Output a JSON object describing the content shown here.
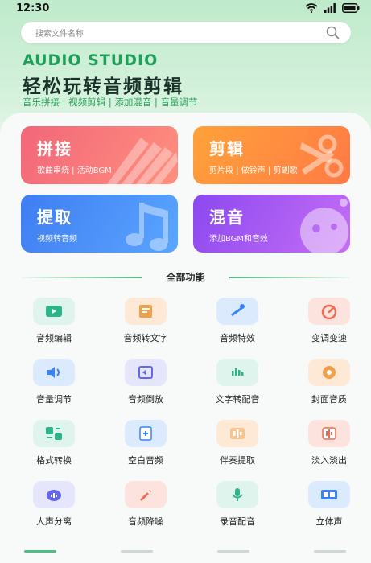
{
  "status": {
    "time": "12:30"
  },
  "search": {
    "placeholder": "搜索文件名称"
  },
  "brand": "AUDIO STUDIO",
  "slogan": "轻松玩转音频剪辑",
  "tags": "音乐拼接 | 视频剪辑 | 添加混音 | 音量调节",
  "cards": [
    {
      "title": "拼接",
      "sub": "歌曲串烧 | 活动BGM",
      "color": "#f2677a"
    },
    {
      "title": "剪辑",
      "sub": "剪片段 | 做铃声 | 剪副歌",
      "color": "#ff8f3a"
    },
    {
      "title": "提取",
      "sub": "视频转音频",
      "color": "#4a8df5"
    },
    {
      "title": "混音",
      "sub": "添加BGM和音效",
      "color": "#a85af3"
    }
  ],
  "section_title": "全部功能",
  "features": [
    {
      "label": "音频编辑",
      "icon": "play-icon",
      "bg": "#dff4ec",
      "fg": "#2fb38a"
    },
    {
      "label": "音频转文字",
      "icon": "document-icon",
      "bg": "#fde9d6",
      "fg": "#f0a04b"
    },
    {
      "label": "音频特效",
      "icon": "magic-wand-icon",
      "bg": "#dbeafd",
      "fg": "#3b82f6"
    },
    {
      "label": "变调变速",
      "icon": "speedometer-icon",
      "bg": "#fde3dd",
      "fg": "#f06a4f"
    },
    {
      "label": "音量调节",
      "icon": "speaker-icon",
      "bg": "#dbeafd",
      "fg": "#3b82f6"
    },
    {
      "label": "音频倒放",
      "icon": "rewind-icon",
      "bg": "#e5e5fb",
      "fg": "#6366f1"
    },
    {
      "label": "文字转配音",
      "icon": "waveform-icon",
      "bg": "#dff4ec",
      "fg": "#2fb38a"
    },
    {
      "label": "封面音质",
      "icon": "disc-icon",
      "bg": "#fde9d6",
      "fg": "#f0a04b"
    },
    {
      "label": "格式转换",
      "icon": "convert-icon",
      "bg": "#dff4ec",
      "fg": "#2fb38a"
    },
    {
      "label": "空白音频",
      "icon": "add-file-icon",
      "bg": "#dbeafd",
      "fg": "#3b82f6"
    },
    {
      "label": "伴奏提取",
      "icon": "extract-icon",
      "bg": "#fde9d6",
      "fg": "#f0a04b"
    },
    {
      "label": "淡入淡出",
      "icon": "fade-wave-icon",
      "bg": "#fde3dd",
      "fg": "#f06a4f"
    },
    {
      "label": "人声分离",
      "icon": "voice-separate-icon",
      "bg": "#e5e5fb",
      "fg": "#6366f1"
    },
    {
      "label": "音频降噪",
      "icon": "rocket-icon",
      "bg": "#fde3dd",
      "fg": "#f06a4f"
    },
    {
      "label": "录音配音",
      "icon": "microphone-icon",
      "bg": "#dff4ec",
      "fg": "#2fb38a"
    },
    {
      "label": "立体声",
      "icon": "stereo-icon",
      "bg": "#dbeafd",
      "fg": "#3b82f6"
    }
  ]
}
